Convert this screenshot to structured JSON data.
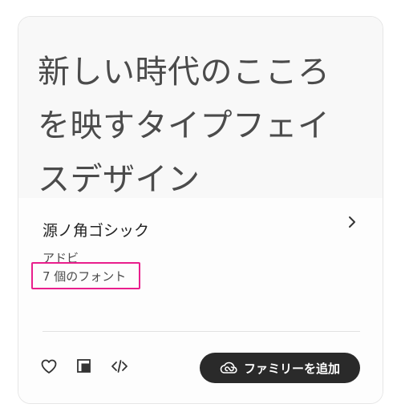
{
  "sample": {
    "text": "新しい時代のこころを映すタイプフェイスデザイン"
  },
  "family": {
    "name": "源ノ角ゴシック",
    "foundry": "アドビ",
    "font_count": "7 個のフォント"
  },
  "actions": {
    "add_family_label": "ファミリーを追加"
  },
  "icons": {
    "favorite": "heart-icon",
    "sample": "sample-text-icon",
    "embed": "code-icon",
    "details": "chevron-right-icon",
    "creative_cloud": "creative-cloud-icon"
  },
  "colors": {
    "highlight": "#e91e8c",
    "button_bg": "#2a2a2a",
    "text": "#4b4b4b"
  }
}
